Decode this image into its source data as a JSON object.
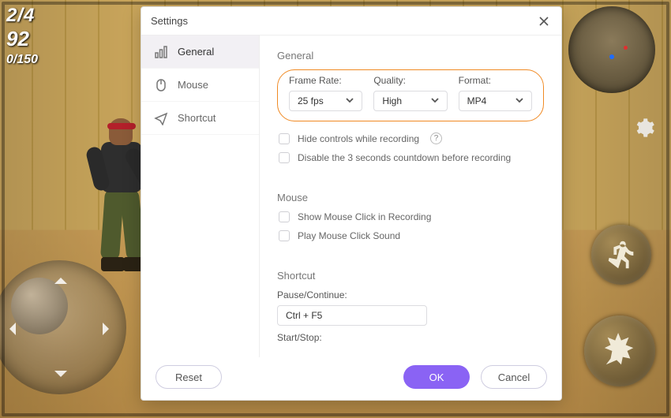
{
  "hud": {
    "line1": "2/4",
    "line2": "92",
    "line3": "0/150"
  },
  "dialog": {
    "title": "Settings",
    "nav": {
      "general": "General",
      "mouse": "Mouse",
      "shortcut": "Shortcut"
    },
    "general": {
      "heading": "General",
      "frame_rate_label": "Frame Rate:",
      "frame_rate_value": "25 fps",
      "quality_label": "Quality:",
      "quality_value": "High",
      "format_label": "Format:",
      "format_value": "MP4",
      "hide_controls": "Hide controls while recording",
      "disable_countdown": "Disable the 3 seconds countdown before recording"
    },
    "mouse": {
      "heading": "Mouse",
      "show_click": "Show Mouse Click in Recording",
      "play_sound": "Play Mouse Click Sound"
    },
    "shortcut": {
      "heading": "Shortcut",
      "pause_label": "Pause/Continue:",
      "pause_value": "Ctrl + F5",
      "start_label": "Start/Stop:"
    },
    "buttons": {
      "reset": "Reset",
      "ok": "OK",
      "cancel": "Cancel"
    }
  }
}
